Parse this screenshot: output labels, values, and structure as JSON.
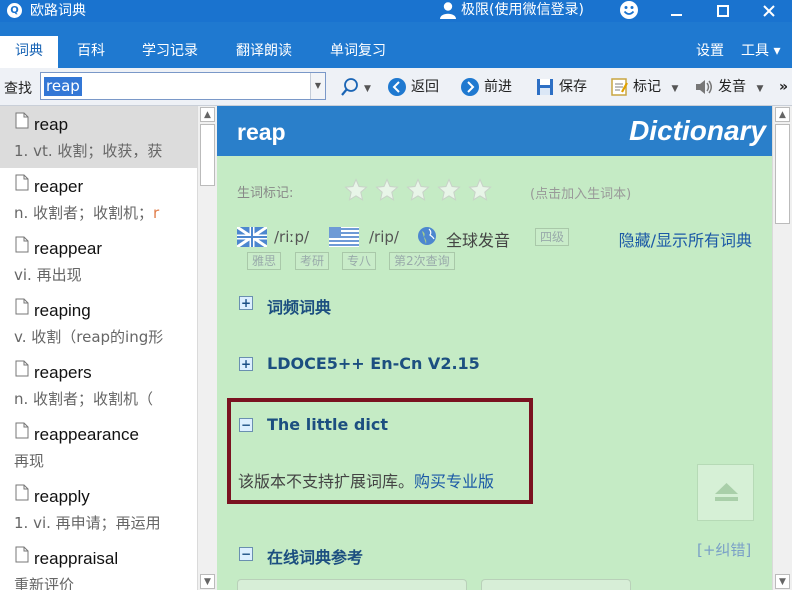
{
  "titlebar": {
    "app_title": "欧路词典",
    "user_label": "极限(使用微信登录)"
  },
  "menubar": {
    "tabs": [
      {
        "label": "词典",
        "active": true
      },
      {
        "label": "百科"
      },
      {
        "label": "学习记录"
      },
      {
        "label": "翻译朗读"
      },
      {
        "label": "单词复习"
      }
    ],
    "settings": "设置",
    "tools": "工具 ▾"
  },
  "toolbar": {
    "search_label": "查找",
    "search_value": "reap",
    "back": "返回",
    "forward": "前进",
    "save": "保存",
    "mark": "标记",
    "speak": "发音",
    "more": "»"
  },
  "word_list": [
    {
      "word": "reap",
      "def": "1. vt. 收割；收获，获",
      "selected": true
    },
    {
      "word": "reaper",
      "def": "n. 收割者；收割机；",
      "accent": "r"
    },
    {
      "word": "reappear",
      "def": "vi. 再出现"
    },
    {
      "word": "reaping",
      "def": "v. 收割（reap的ing形"
    },
    {
      "word": "reapers",
      "def": "n. 收割者；收割机（"
    },
    {
      "word": "reappearance",
      "def": "再现"
    },
    {
      "word": "reapply",
      "def": "1. vi. 再申请；再运用"
    },
    {
      "word": "reappraisal",
      "def": "重新评价"
    }
  ],
  "dict": {
    "word": "reap",
    "brand": "Dictionary",
    "star_label": "生词标记:",
    "star_hint": "(点击加入生词本)",
    "stars": 0,
    "phonetic_uk": "/riːp/",
    "phonetic_us": "/rip/",
    "global_pron": "全球发音",
    "tags": [
      "四级",
      "雅思",
      "考研",
      "专八",
      "第2次查询"
    ],
    "toggle_all": "隐藏/显示所有词典",
    "sections": [
      {
        "title": "词频词典",
        "expanded": false
      },
      {
        "title": "LDOCE5++ En-Cn V2.15",
        "expanded": false
      },
      {
        "title": "The little dict",
        "expanded": true
      },
      {
        "title": "在线词典参考",
        "expanded": true
      }
    ],
    "unsupported_text": "该版本不支持扩展词库。",
    "buy_link": "购买专业版",
    "report_error": "[+纠错]"
  },
  "colors": {
    "brand_blue": "#1a73cf",
    "dict_bg": "#c5ebc5",
    "highlight_border": "#7a1220"
  }
}
